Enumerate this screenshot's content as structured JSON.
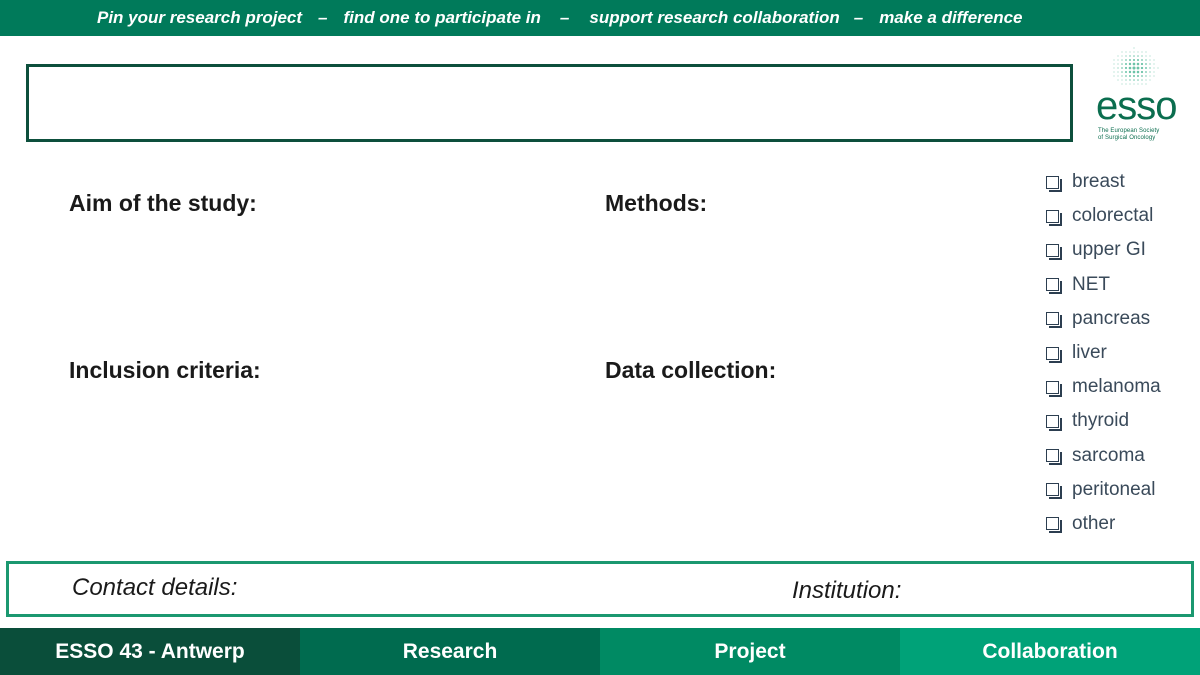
{
  "banner": {
    "segments": [
      "Pin your research project",
      "find one to participate in",
      "support research collaboration",
      "make a difference"
    ],
    "separator": "–",
    "color": "#007a5a"
  },
  "logo": {
    "word": "esso",
    "subtitle_line1": "The European Society",
    "subtitle_line2": "of Surgical Oncology",
    "color": "#0b6e4f"
  },
  "sections": {
    "aim": "Aim of the study:",
    "methods": "Methods:",
    "inclusion": "Inclusion criteria:",
    "data_collection": "Data collection:"
  },
  "checklist": [
    "breast",
    "colorectal",
    "upper GI",
    "NET",
    "pancreas",
    "liver",
    "melanoma",
    "thyroid",
    "sarcoma",
    "peritoneal",
    "other"
  ],
  "contact": {
    "contact_label": "Contact details:",
    "institution_label": "Institution:"
  },
  "footer": [
    {
      "label": "ESSO 43 - Antwerp",
      "color": "#0a4e3a"
    },
    {
      "label": "Research",
      "color": "#006b4f"
    },
    {
      "label": "Project",
      "color": "#008a63"
    },
    {
      "label": "Collaboration",
      "color": "#00a278"
    }
  ]
}
